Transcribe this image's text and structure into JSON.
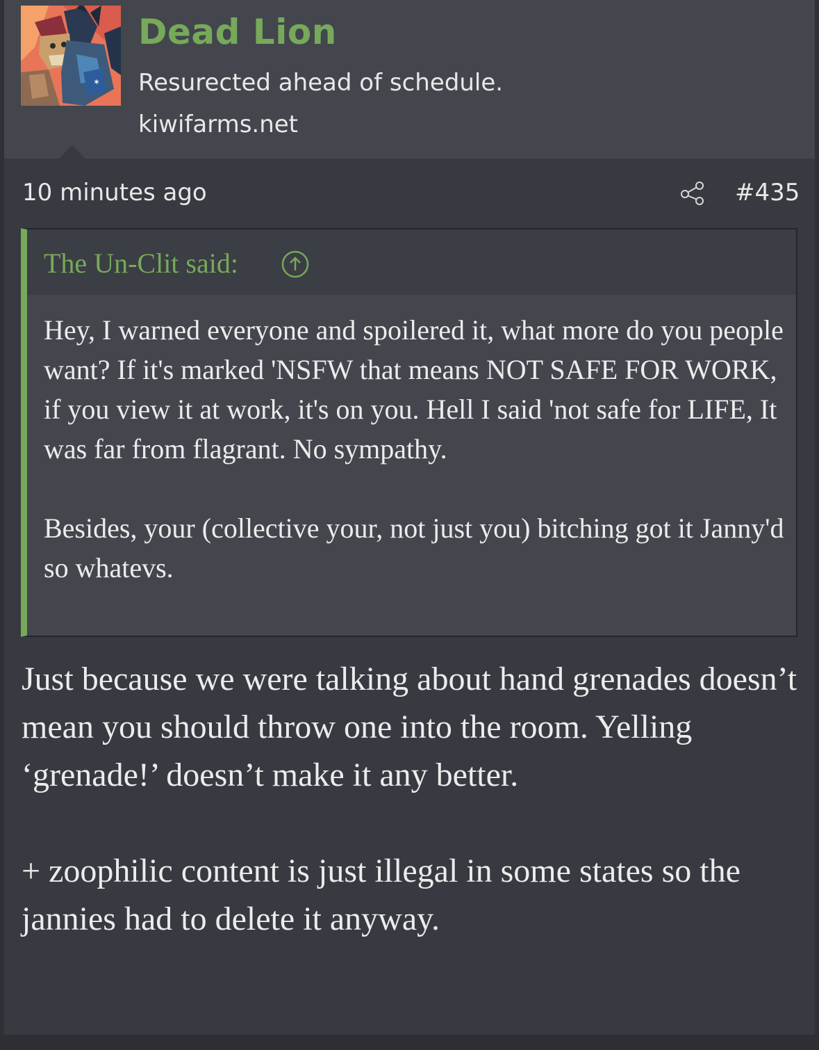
{
  "user": {
    "name": "Dead Lion",
    "title": "Resurected ahead of schedule.",
    "site": "kiwifarms.net",
    "avatar_icon": "avatar-image"
  },
  "post": {
    "time": "10 minutes ago",
    "share_icon": "share-icon",
    "number": "#435"
  },
  "quote": {
    "author": "The Un-Clit said:",
    "arrow_icon": "arrow-up-circle-icon",
    "paragraphs": [
      "Hey, I warned everyone and spoilered it, what more do you people want? If it's marked 'NSFW that means NOT SAFE FOR WORK, if you view it at work, it's on you. Hell I said 'not safe for LIFE, It was far from flagrant. No sympathy.",
      "Besides, your (collective your, not just you) bitching got it Janny'd so whatevs."
    ]
  },
  "reply": {
    "paragraphs": [
      "Just because we were talking about hand grenades doesn’t mean you should throw one into the room. Yelling ‘grenade!’ doesn’t make it any better.",
      "+ zoophilic content is just illegal in some states so the jannies had to delete it anyway."
    ]
  },
  "colors": {
    "background": "#373a40",
    "header_background": "#43464d",
    "accent_green": "#77a95a",
    "text": "#ececec"
  }
}
